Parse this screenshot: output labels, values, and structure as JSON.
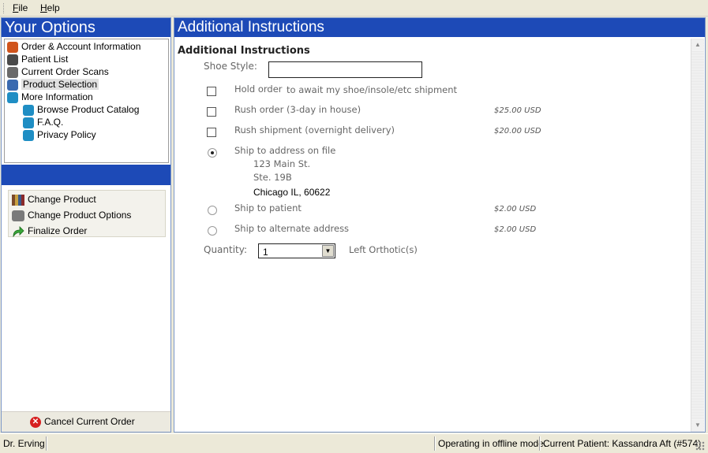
{
  "menu": {
    "file": "File",
    "help": "Help"
  },
  "left_panel": {
    "title": "Your Options",
    "tree": [
      {
        "label": "Order & Account Information",
        "icon": "order-icon",
        "color": "#d0541c"
      },
      {
        "label": "Patient List",
        "icon": "patient-icon",
        "color": "#4a4a4a"
      },
      {
        "label": "Current Order Scans",
        "icon": "scan-icon",
        "color": "#6a6a6a"
      },
      {
        "label": "Product Selection",
        "icon": "product-icon",
        "color": "#3a6ab0",
        "selected": true
      },
      {
        "label": "More Information",
        "icon": "info-book-icon",
        "color": "#1f8ec4"
      },
      {
        "label": "Browse Product Catalog",
        "icon": "book-icon",
        "color": "#1f8ec4"
      },
      {
        "label": "F.A.Q.",
        "icon": "book-icon",
        "color": "#1f8ec4"
      },
      {
        "label": "Privacy Policy",
        "icon": "book-icon",
        "color": "#1f8ec4"
      }
    ],
    "actions": [
      {
        "label": "Change Product",
        "icon": "books-icon"
      },
      {
        "label": "Change Product Options",
        "icon": "options-icon"
      },
      {
        "label": "Finalize Order",
        "icon": "green-arrow-icon"
      }
    ],
    "cancel_label": "Cancel Current Order"
  },
  "right_panel": {
    "title": "Additional Instructions",
    "section_title": "Additional Instructions",
    "shoe_style_label": "Shoe Style:",
    "shoe_style_value": "",
    "options": {
      "hold": "Hold order",
      "hold_suffix": "to await my shoe/insole/etc shipment",
      "rush_order": "Rush order (3-day in house)",
      "rush_order_price": "$25.00 USD",
      "rush_ship": "Rush shipment (overnight delivery)",
      "rush_ship_price": "$20.00 USD",
      "ship_file": "Ship to address on file",
      "address_line1": "123 Main St.",
      "address_line2": "Ste. 19B",
      "address_line3": "Chicago IL, 60622",
      "ship_patient": "Ship to patient",
      "ship_patient_price": "$2.00 USD",
      "ship_alt": "Ship to alternate address",
      "ship_alt_price": "$2.00 USD"
    },
    "quantity_label": "Quantity:",
    "quantity_value": "1",
    "quantity_suffix": "Left Orthotic(s)"
  },
  "status": {
    "doctor": "Dr. Erving",
    "mode": "Operating in offline mode.",
    "patient": "Current Patient: Kassandra Aft (#574)"
  },
  "colors": {
    "header_blue": "#1d4ab7",
    "chrome": "#ece9d8"
  }
}
